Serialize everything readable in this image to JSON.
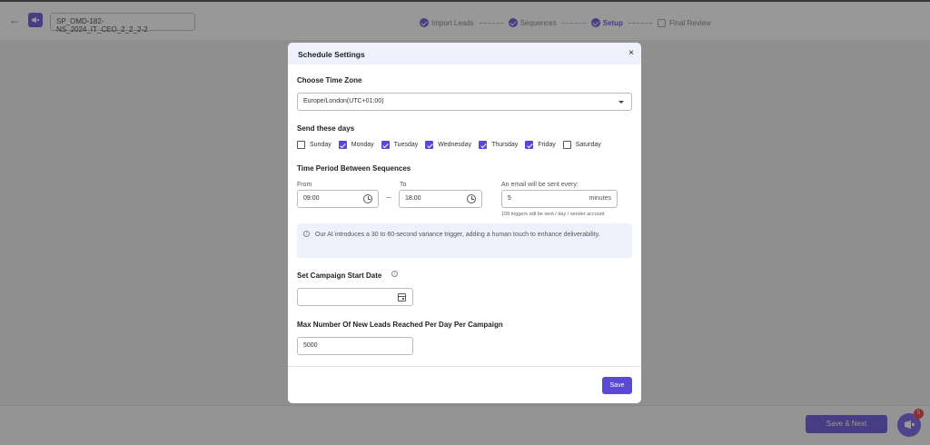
{
  "header": {
    "campaign_name": "SP_OMD-182-NS_2024_IT_CEO_2_2_2-2",
    "steps": [
      {
        "label": "Import Leads",
        "state": "done"
      },
      {
        "label": "Sequences",
        "state": "done"
      },
      {
        "label": "Setup",
        "state": "active"
      },
      {
        "label": "Final Review",
        "state": "pending"
      }
    ]
  },
  "footer": {
    "save_next_label": "Save & Next",
    "notification_count": "5"
  },
  "modal": {
    "title": "Schedule Settings",
    "close_label": "×",
    "timezone": {
      "label": "Choose Time Zone",
      "value": "Europe/London(UTC+01:00)"
    },
    "days": {
      "label": "Send these days",
      "items": [
        {
          "name": "Sunday",
          "checked": false
        },
        {
          "name": "Monday",
          "checked": true
        },
        {
          "name": "Tuesday",
          "checked": true
        },
        {
          "name": "Wednesday",
          "checked": true
        },
        {
          "name": "Thursday",
          "checked": true
        },
        {
          "name": "Friday",
          "checked": true
        },
        {
          "name": "Saturday",
          "checked": false
        }
      ]
    },
    "time_period": {
      "label": "Time Period Between Sequences",
      "from_label": "From",
      "from_value": "09:00",
      "to_label": "To",
      "to_value": "18:00",
      "interval_label": "An email will be sent every:",
      "interval_value": "5",
      "interval_unit": "minutes",
      "triggers_note": "108 triggers will be sent / day / sender account"
    },
    "info_text": "Our AI introduces a 30 to 60-second variance trigger, adding a human touch to enhance deliverability.",
    "start_date": {
      "label": "Set Campaign Start Date",
      "value": ""
    },
    "max_leads": {
      "label": "Max Number Of New Leads Reached Per Day Per Campaign",
      "value": "5000"
    },
    "save_label": "Save"
  },
  "colors": {
    "accent": "#5b48d6",
    "info_bg": "#eef1fb",
    "badge": "#e03131"
  }
}
